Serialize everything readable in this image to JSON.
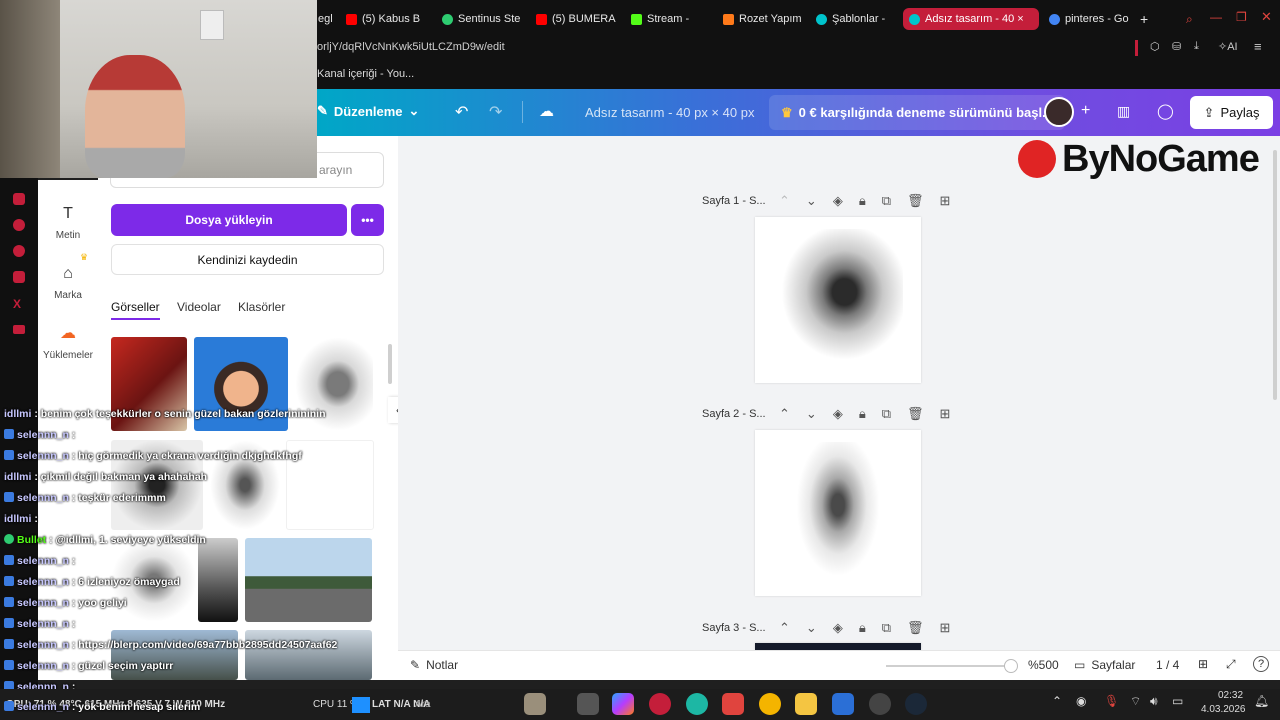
{
  "browser": {
    "tabs": [
      {
        "label": "egl",
        "color": "#888888"
      },
      {
        "label": "(5) Kabus B",
        "color": "#ff0000"
      },
      {
        "label": "Sentinus Ste",
        "color": "#2ecc71"
      },
      {
        "label": "(5) BUMERA",
        "color": "#ff0000"
      },
      {
        "label": "Stream -",
        "color": "#53fc18"
      },
      {
        "label": "Rozet Yapım",
        "color": "#ff7a1a"
      },
      {
        "label": "Şablonlar -",
        "color": "#00c4cc"
      },
      {
        "label": "Adsız tasarım - 40 ×",
        "color": "#00c4cc"
      },
      {
        "label": "pinteres - Go",
        "color": "#4285f4"
      }
    ],
    "new_tab": "+",
    "url": "orljY/dqRlVcNnKwk5iUtLCZmD9w/edit",
    "bookmark": "Kanal içeriği - You...",
    "ai_label": "AI"
  },
  "canva_header": {
    "edit_label": "Düzenleme",
    "doc_title": "Adsız tasarım - 40 px × 40 px",
    "trial_label": "0 € karşılığında deneme sürümünü başl...",
    "share_label": "Paylaş"
  },
  "brand_overlay": "ByNoGame",
  "sidebar": {
    "items": [
      {
        "label": "Metin",
        "icon": "text-icon"
      },
      {
        "label": "Marka",
        "icon": "brand-icon"
      },
      {
        "label": "Yüklemeler",
        "icon": "upload-icon"
      }
    ]
  },
  "panel": {
    "search_placeholder": "arayın",
    "upload_button": "Dosya yükleyin",
    "more_button": "•••",
    "record_button": "Kendinizi kaydedin",
    "tabs": [
      "Görseller",
      "Videolar",
      "Klasörler"
    ],
    "collapse": "‹"
  },
  "pages": [
    {
      "label": "Sayfa 1 - S..."
    },
    {
      "label": "Sayfa 2 - S..."
    },
    {
      "label": "Sayfa 3 - S..."
    }
  ],
  "bottom_bar": {
    "notes": "Notlar",
    "zoom": "%500",
    "pages_label": "Sayfalar",
    "page_count": "1 / 4",
    "help": "?"
  },
  "chat": [
    {
      "user": "idllmi",
      "text": ": benim çok teşekkürler o senin güzel bakan gözlerinininin"
    },
    {
      "user": "selennn_n",
      "text": ":"
    },
    {
      "user": "selennn_n",
      "text": ": hiç görmedik ya ekrana verdiğin dkjghdkfhgf"
    },
    {
      "user": "idllmi",
      "text": ": çikmil değil bakman ya ahahahah"
    },
    {
      "user": "selennn_n",
      "text": ": teşkür ederimmm"
    },
    {
      "user": "idllmi",
      "text": ":"
    },
    {
      "user": "Bullet",
      "text": ": @idllmi, 1. seviyeye yükseldin"
    },
    {
      "user": "selennn_n",
      "text": ":"
    },
    {
      "user": "selennn_n",
      "text": ": 6 izleniyoz ömaygad"
    },
    {
      "user": "selennn_n",
      "text": ": yoo geliyi"
    },
    {
      "user": "selennn_n",
      "text": ":"
    },
    {
      "user": "selennn_n",
      "text": ": https://blerp.com/video/69a77bbb2895dd24507aaf62"
    },
    {
      "user": "selennn_n",
      "text": ": güzel seçim yaptırr"
    },
    {
      "user": "selennn_n",
      "text": ":"
    },
    {
      "user": "selennn_n",
      "text": ": yok benim hesap silerim"
    }
  ],
  "taskbar": {
    "stats_left": "GPU: 71 % 48°C 615 MHz 8.635 V 7 W 810 MHz",
    "cpu": "CPU 11 %",
    "lat": "LAT N/A N/A",
    "search": "Ara",
    "time": "02:32",
    "date": "4.03.2026"
  },
  "colors": {
    "accent": "#7d2ae8",
    "tab_active": "#c41e3a",
    "header_start": "#00a7c7",
    "header_end": "#7b3fe4"
  }
}
